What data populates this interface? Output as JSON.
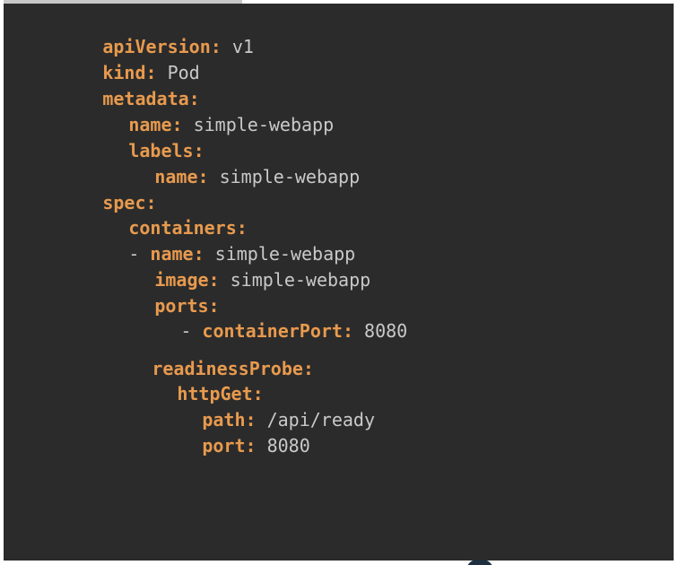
{
  "code": {
    "lines": [
      {
        "key": "apiVersion:",
        "value": " v1"
      },
      {
        "key": "kind:",
        "value": " Pod"
      },
      {
        "key": "metadata:",
        "value": ""
      },
      {
        "key": "name:",
        "value": " simple-webapp"
      },
      {
        "key": "labels:",
        "value": ""
      },
      {
        "key": "name:",
        "value": " simple-webapp"
      },
      {
        "key": "spec:",
        "value": ""
      },
      {
        "key": "containers:",
        "value": ""
      },
      {
        "key": "name:",
        "value": " simple-webapp"
      },
      {
        "key": "image:",
        "value": " simple-webapp"
      },
      {
        "key": "ports:",
        "value": ""
      },
      {
        "key": "containerPort:",
        "value": " 8080"
      },
      {
        "key": "readinessProbe:",
        "value": ""
      },
      {
        "key": "httpGet:",
        "value": ""
      },
      {
        "key": "path:",
        "value": " /api/ready"
      },
      {
        "key": "port:",
        "value": " 8080"
      }
    ],
    "list_marker": "-"
  }
}
